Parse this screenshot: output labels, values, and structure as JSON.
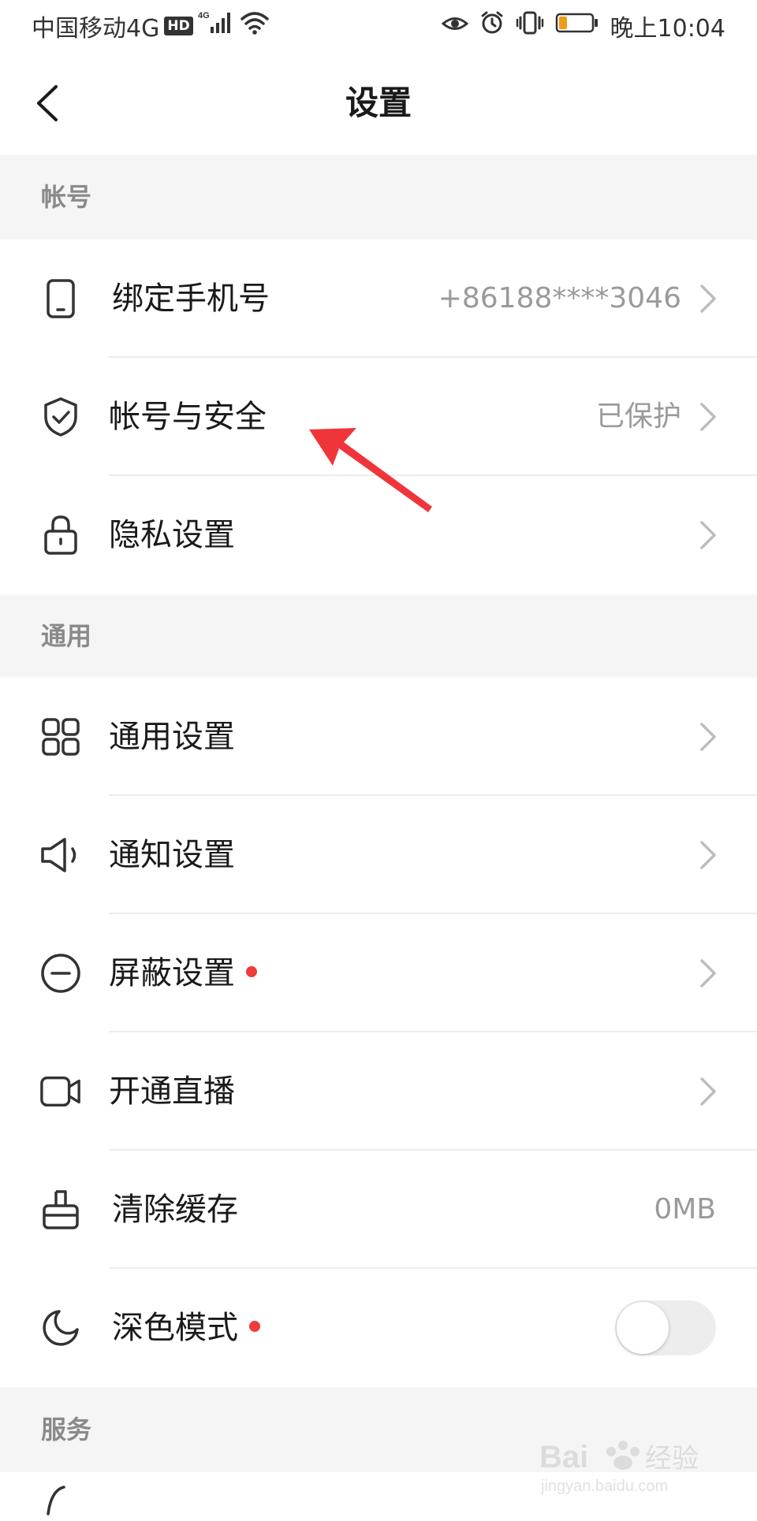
{
  "status_bar": {
    "carrier": "中国移动4G",
    "hd": "HD",
    "signal_tag": "4G",
    "time": "晚上10:04",
    "battery_color": "#f29a1a"
  },
  "header": {
    "title": "设置",
    "back_icon": "chevron-left-icon"
  },
  "sections": {
    "account": {
      "title": "帐号",
      "items": [
        {
          "label": "绑定手机号",
          "value": "+86188****3046",
          "icon": "phone-icon"
        },
        {
          "label": "帐号与安全",
          "value": "已保护",
          "icon": "shield-check-icon"
        },
        {
          "label": "隐私设置",
          "value": "",
          "icon": "lock-icon"
        }
      ]
    },
    "general": {
      "title": "通用",
      "items": [
        {
          "label": "通用设置",
          "icon": "grid-icon"
        },
        {
          "label": "通知设置",
          "icon": "speaker-icon"
        },
        {
          "label": "屏蔽设置",
          "icon": "minus-circle-icon",
          "badge": true
        },
        {
          "label": "开通直播",
          "icon": "video-camera-icon"
        },
        {
          "label": "清除缓存",
          "value": "0MB",
          "icon": "brush-icon"
        },
        {
          "label": "深色模式",
          "icon": "moon-icon",
          "badge": true,
          "toggle_on": false
        }
      ]
    },
    "service": {
      "title": "服务"
    }
  },
  "colors": {
    "accent_red": "#ee3b3b",
    "section_bg": "#f5f5f5",
    "annotation_red": "#f0353a"
  },
  "watermark": {
    "brand": "Bai",
    "brand2": "经验",
    "url": "jingyan.baidu.com"
  }
}
